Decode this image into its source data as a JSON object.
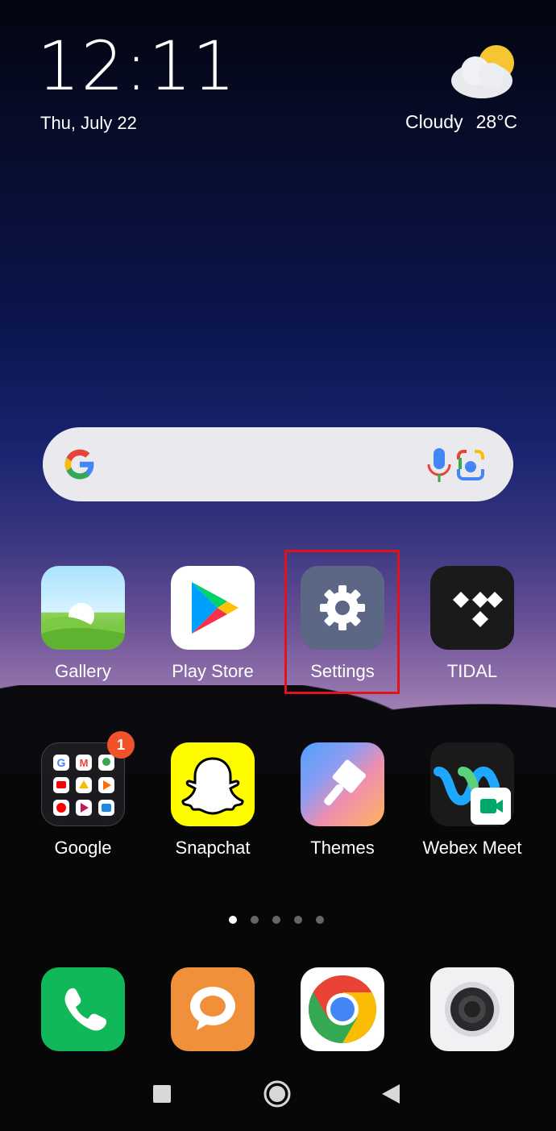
{
  "status": {
    "time": "12:11",
    "date": "Thu, July 22",
    "weather_condition": "Cloudy",
    "temperature": "28°C"
  },
  "search_bar": {
    "icon": "google-g-icon"
  },
  "apps_row1": [
    {
      "label": "Gallery"
    },
    {
      "label": "Play Store"
    },
    {
      "label": "Settings"
    },
    {
      "label": "TIDAL"
    }
  ],
  "apps_row2": [
    {
      "label": "Google",
      "badge": "1"
    },
    {
      "label": "Snapchat"
    },
    {
      "label": "Themes"
    },
    {
      "label": "Webex Meet"
    }
  ],
  "dock": [
    "phone-icon",
    "messages-icon",
    "chrome-icon",
    "camera-icon"
  ],
  "page_indicator": {
    "pages": 5,
    "current": 1
  },
  "nav": [
    "recents-button",
    "home-button",
    "back-button"
  ],
  "colors": {
    "highlight": "#e0121b",
    "badge": "#f0522a"
  }
}
